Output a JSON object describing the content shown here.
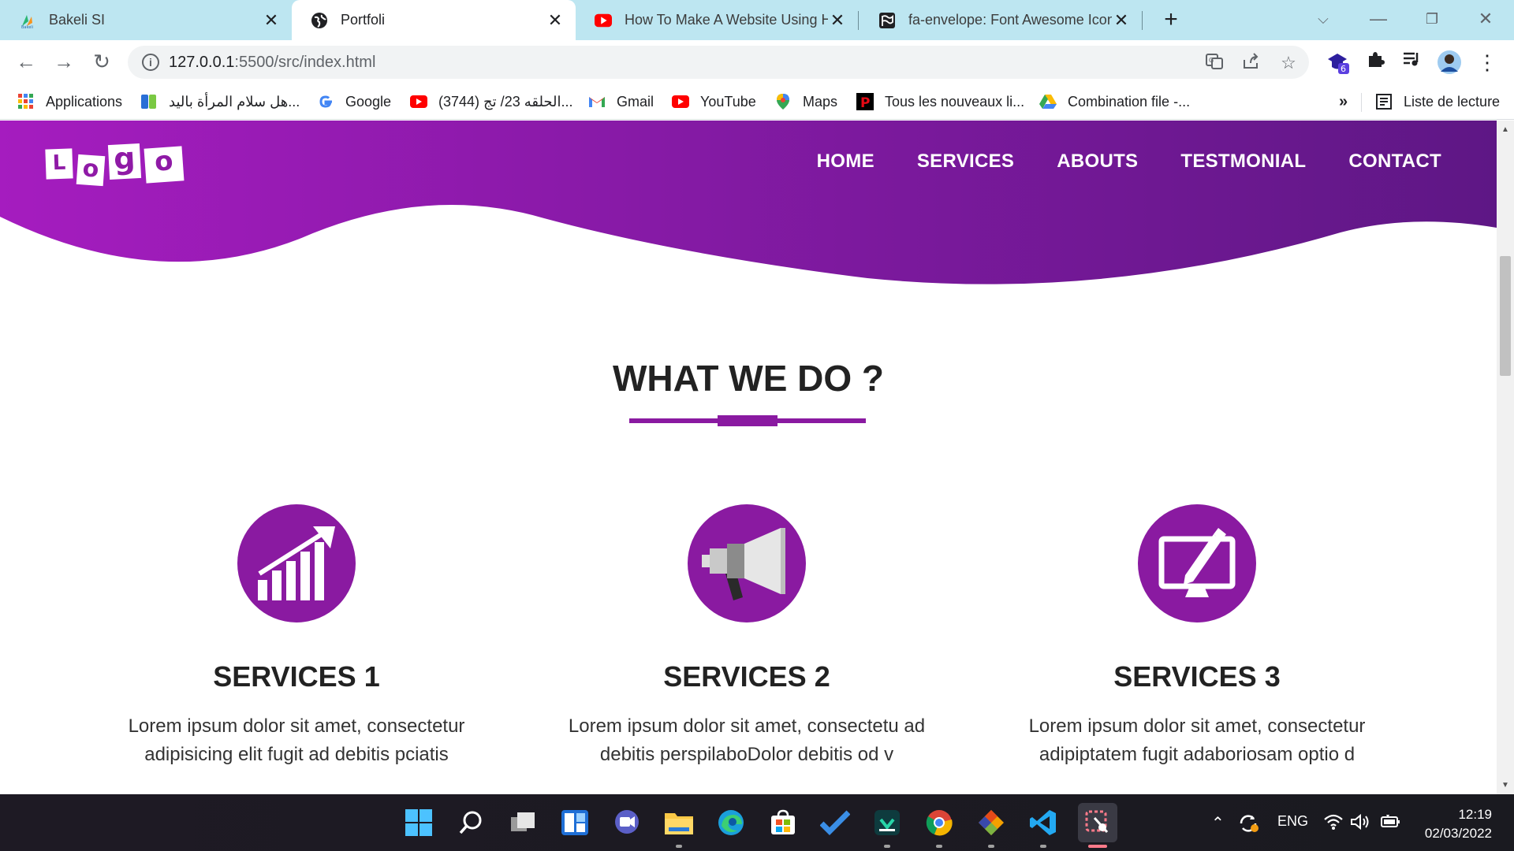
{
  "browser": {
    "tabs": [
      {
        "title": "Bakeli SI",
        "icon": "bakeli-favicon",
        "active": false
      },
      {
        "title": "Portfoli",
        "icon": "globe-icon",
        "active": true
      },
      {
        "title": "How To Make A Website Using H",
        "icon": "youtube-icon",
        "active": false
      },
      {
        "title": "fa-envelope: Font Awesome Icon",
        "icon": "flag-icon",
        "active": false
      }
    ],
    "new_tab": "+",
    "url_host": "127.0.0.1",
    "url_path": ":5500/src/index.html",
    "extension_badge": "6"
  },
  "bookmarks": [
    {
      "label": "Applications",
      "icon": "apps-grid-icon"
    },
    {
      "label": "هل سلام المرأة باليد...",
      "icon": "bookmark-icon"
    },
    {
      "label": "Google",
      "icon": "google-icon"
    },
    {
      "label": "(3744) الحلقه 23/ تج...",
      "icon": "youtube-icon"
    },
    {
      "label": "Gmail",
      "icon": "gmail-icon"
    },
    {
      "label": "YouTube",
      "icon": "youtube-icon"
    },
    {
      "label": "Maps",
      "icon": "maps-icon"
    },
    {
      "label": "Tous les nouveaux li...",
      "icon": "p-icon"
    },
    {
      "label": "Combination file -...",
      "icon": "drive-icon"
    }
  ],
  "bookmarks_more": "»",
  "reading_list": "Liste de lecture",
  "page": {
    "logo_letters": [
      "L",
      "o",
      "g",
      "o"
    ],
    "nav": [
      "HOME",
      "SERVICES",
      "ABOUTS",
      "TESTMONIAL",
      "CONTACT"
    ],
    "section_title": "WHAT WE DO ?",
    "services": [
      {
        "title": "SERVICES 1",
        "icon": "chart-growth-icon",
        "line1": "Lorem ipsum dolor sit amet, consectetur",
        "line2": "adipisicing elit fugit ad debitis pciatis"
      },
      {
        "title": "SERVICES 2",
        "icon": "megaphone-icon",
        "line1": "Lorem ipsum dolor sit amet, consectetu ad",
        "line2": "debitis perspilaboDolor debitis od v"
      },
      {
        "title": "SERVICES 3",
        "icon": "monitor-pen-icon",
        "line1": "Lorem ipsum dolor sit amet, consectetur",
        "line2": "adipiptatem fugit adaboriosam optio d"
      }
    ]
  },
  "taskbar": {
    "language": "ENG",
    "time": "12:19",
    "date": "02/03/2022"
  },
  "colors": {
    "brand_purple": "#8a1aa1",
    "hero_start": "#a51cbf",
    "hero_end": "#5e1785"
  }
}
